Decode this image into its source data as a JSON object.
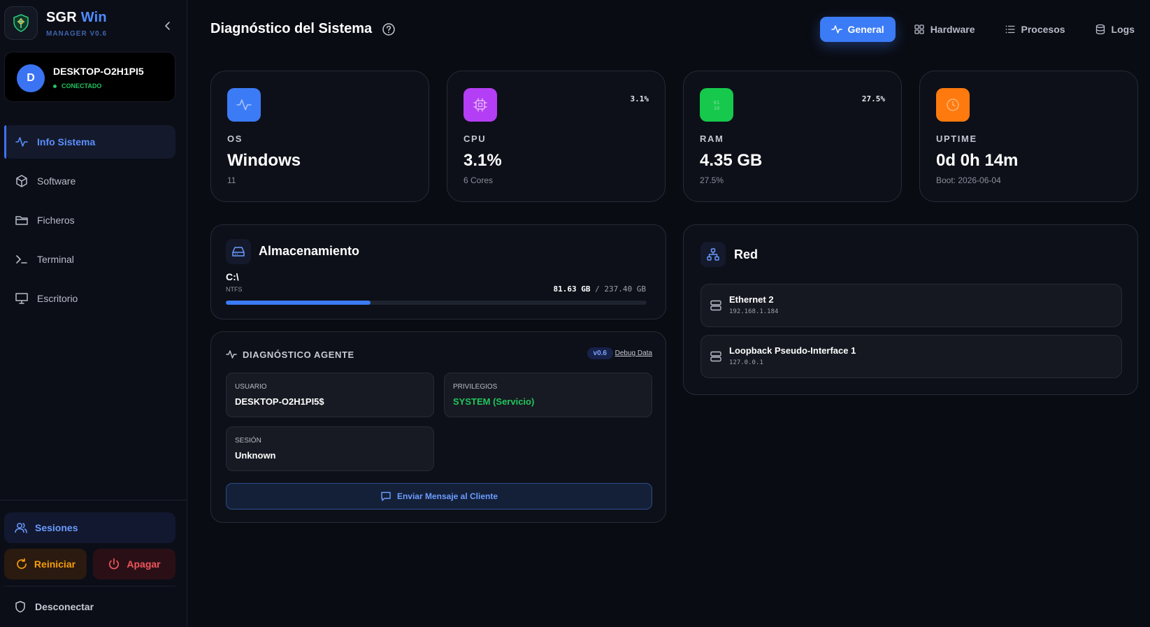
{
  "sidebar": {
    "brand": {
      "name_main": "SGR",
      "name_accent": "Win",
      "subtitle": "MANAGER V0.6"
    },
    "device": {
      "initial": "D",
      "name": "DESKTOP-O2H1PI5",
      "status": "CONECTADO"
    },
    "nav": [
      {
        "label": "Info Sistema",
        "icon": "activity-icon",
        "active": true
      },
      {
        "label": "Software",
        "icon": "package-icon",
        "active": false
      },
      {
        "label": "Ficheros",
        "icon": "folder-icon",
        "active": false
      },
      {
        "label": "Terminal",
        "icon": "terminal-icon",
        "active": false
      },
      {
        "label": "Escritorio",
        "icon": "monitor-icon",
        "active": false
      }
    ],
    "sessions_label": "Sesiones",
    "restart_label": "Reiniciar",
    "power_label": "Apagar",
    "disconnect_label": "Desconectar"
  },
  "header": {
    "title": "Diagnóstico del Sistema",
    "tabs": [
      {
        "label": "General",
        "icon": "activity-icon",
        "active": true
      },
      {
        "label": "Hardware",
        "icon": "grid-icon",
        "active": false
      },
      {
        "label": "Procesos",
        "icon": "list-icon",
        "active": false
      },
      {
        "label": "Logs",
        "icon": "database-icon",
        "active": false
      }
    ]
  },
  "stats": {
    "os": {
      "label": "OS",
      "value": "Windows",
      "sub": "11",
      "color": "#3b7bf6"
    },
    "cpu": {
      "label": "CPU",
      "value": "3.1%",
      "sub": "6 Cores",
      "pct": "3.1%",
      "color": "#b43ef5"
    },
    "ram": {
      "label": "RAM",
      "value": "4.35 GB",
      "sub": "27.5%",
      "pct": "27.5%",
      "color": "#16c84c"
    },
    "uptime": {
      "label": "UPTIME",
      "value": "0d 0h 14m",
      "sub": "Boot: 2026-06-04",
      "color": "#ff7a0e"
    }
  },
  "storage": {
    "title": "Almacenamiento",
    "drive": "C:\\",
    "fs": "NTFS",
    "used": "81.63 GB",
    "separator": "/",
    "total": "237.40 GB",
    "used_fraction": 0.344
  },
  "agent": {
    "title": "DIAGNÓSTICO AGENTE",
    "version": "v0.6",
    "debug_label": "Debug Data",
    "user_label": "USUARIO",
    "user_value": "DESKTOP-O2H1PI5$",
    "priv_label": "PRIVILEGIOS",
    "priv_value": "SYSTEM (Servicio)",
    "session_label": "SESIÓN",
    "session_value": "Unknown",
    "message_button": "Enviar Mensaje al Cliente"
  },
  "network": {
    "title": "Red",
    "interfaces": [
      {
        "name": "Ethernet 2",
        "ip": "192.168.1.184"
      },
      {
        "name": "Loopback Pseudo-Interface 1",
        "ip": "127.0.0.1"
      }
    ]
  }
}
